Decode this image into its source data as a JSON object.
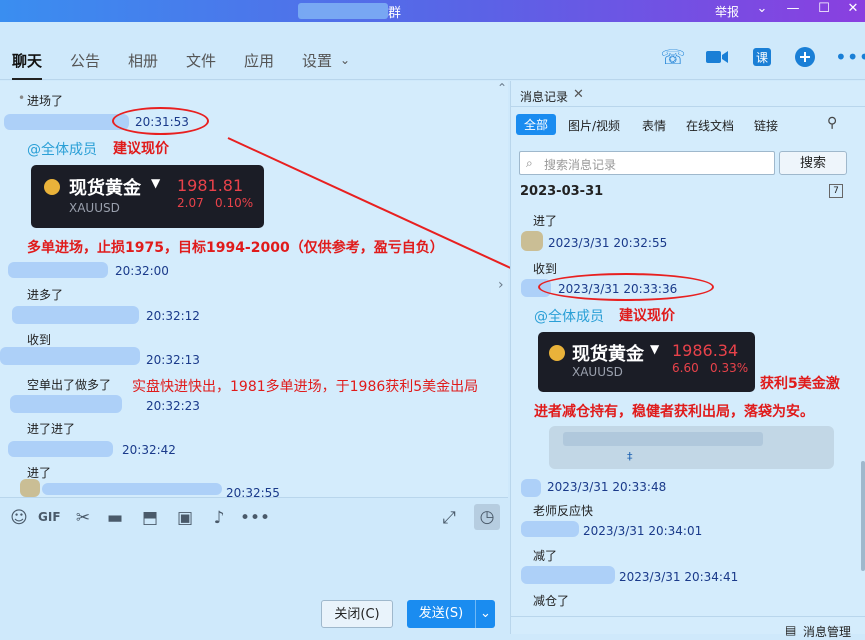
{
  "window": {
    "title_tail": "群",
    "report": "举报"
  },
  "tabs": [
    "聊天",
    "公告",
    "相册",
    "文件",
    "应用",
    "设置"
  ],
  "chat": {
    "m1": "进场了",
    "t1": "20:31:53",
    "mention": "@全体成员",
    "advice": "建议现价",
    "card": {
      "name": "现货黄金",
      "code": "XAUUSD",
      "price": "1981.81",
      "change": "2.07",
      "pct": "0.10%"
    },
    "note1": "多单进场，止损1975，目标1994-2000（仅供参考，盈亏自负）",
    "t2": "20:32:00",
    "m2": "进多了",
    "t3": "20:32:12",
    "m3": "收到",
    "t4": "20:32:13",
    "m4": "空单出了做多了",
    "note2": "实盘快进快出，1981多单进场，于1986获利5美金出局",
    "t5": "20:32:23",
    "m5": "进了进了",
    "t6": "20:32:42",
    "m6": "进了",
    "t7": "20:32:55"
  },
  "buttons": {
    "close": "关闭(C)",
    "send": "发送(S)"
  },
  "right": {
    "title": "消息记录",
    "tabs": [
      "全部",
      "图片/视频",
      "表情",
      "在线文档",
      "链接"
    ],
    "search_placeholder": "搜索消息记录",
    "search_btn": "搜索",
    "date": "2023-03-31",
    "r1": "进了",
    "rt1": "2023/3/31 20:32:55",
    "r2": "收到",
    "rt2": "2023/3/31 20:33:36",
    "mention": "@全体成员",
    "advice": "建议现价",
    "card": {
      "name": "现货黄金",
      "code": "XAUUSD",
      "price": "1986.34",
      "change": "6.60",
      "pct": "0.33%"
    },
    "note_a": "获利5美金激",
    "note_b": "进者减仓持有，稳健者获利出局，落袋为安。",
    "rt3": "2023/3/31 20:33:48",
    "r3": "老师反应快",
    "rt4": "2023/3/31 20:34:01",
    "r4": "减了",
    "rt5": "2023/3/31 20:34:41",
    "r5": "减仓了",
    "manage": "消息管理"
  }
}
